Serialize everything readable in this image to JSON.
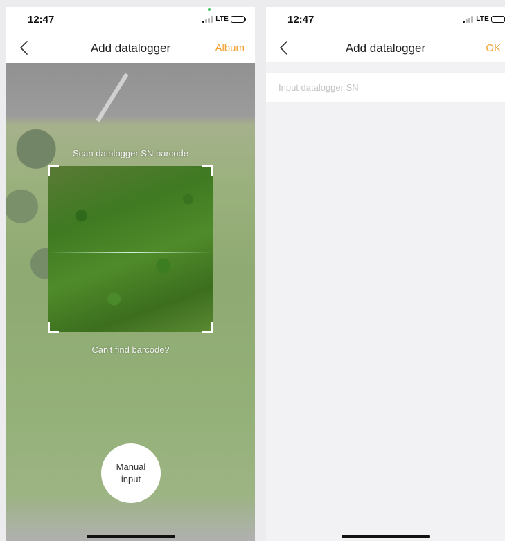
{
  "screens": {
    "scanner": {
      "status_bar": {
        "time": "12:47",
        "network": "LTE"
      },
      "nav": {
        "title": "Add datalogger",
        "action": "Album"
      },
      "scan_hint": "Scan datalogger SN barcode",
      "cant_find": "Can't find barcode?",
      "manual_input": {
        "line1": "Manual",
        "line2": "input"
      }
    },
    "manual": {
      "status_bar": {
        "time": "12:47",
        "network": "LTE"
      },
      "nav": {
        "title": "Add datalogger",
        "action": "OK"
      },
      "sn_input": {
        "placeholder": "Input datalogger SN",
        "value": ""
      }
    }
  },
  "colors": {
    "accent": "#f0a030",
    "background": "#f2f2f4"
  },
  "icons": [
    "back-chevron-icon",
    "signal-icon",
    "battery-icon"
  ]
}
